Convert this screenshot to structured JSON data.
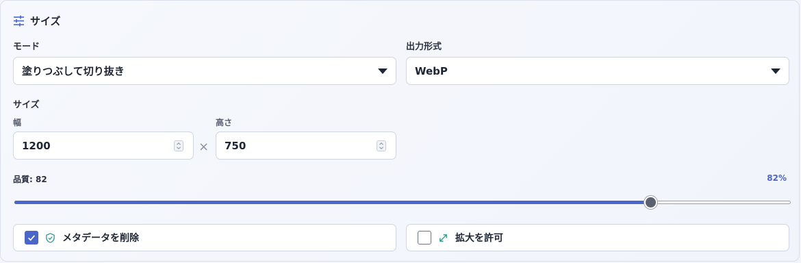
{
  "panel": {
    "title": "サイズ",
    "icon": "sliders-icon"
  },
  "mode": {
    "label": "モード",
    "value": "塗りつぶして切り抜き"
  },
  "format": {
    "label": "出力形式",
    "value": "WebP"
  },
  "size": {
    "label": "サイズ",
    "width_label": "幅",
    "width_value": "1200",
    "height_label": "高さ",
    "height_value": "750",
    "separator": "×"
  },
  "quality": {
    "label": "品質: 82",
    "percent_text": "82%",
    "value": 82,
    "max": 100
  },
  "options": {
    "strip_metadata": {
      "label": "メタデータを削除",
      "checked": true,
      "icon": "shield-check-icon"
    },
    "allow_upscale": {
      "label": "拡大を許可",
      "checked": false,
      "icon": "expand-arrows-icon"
    }
  },
  "colors": {
    "accent": "#4a66c9",
    "icon_accent": "#2e9c8f"
  }
}
